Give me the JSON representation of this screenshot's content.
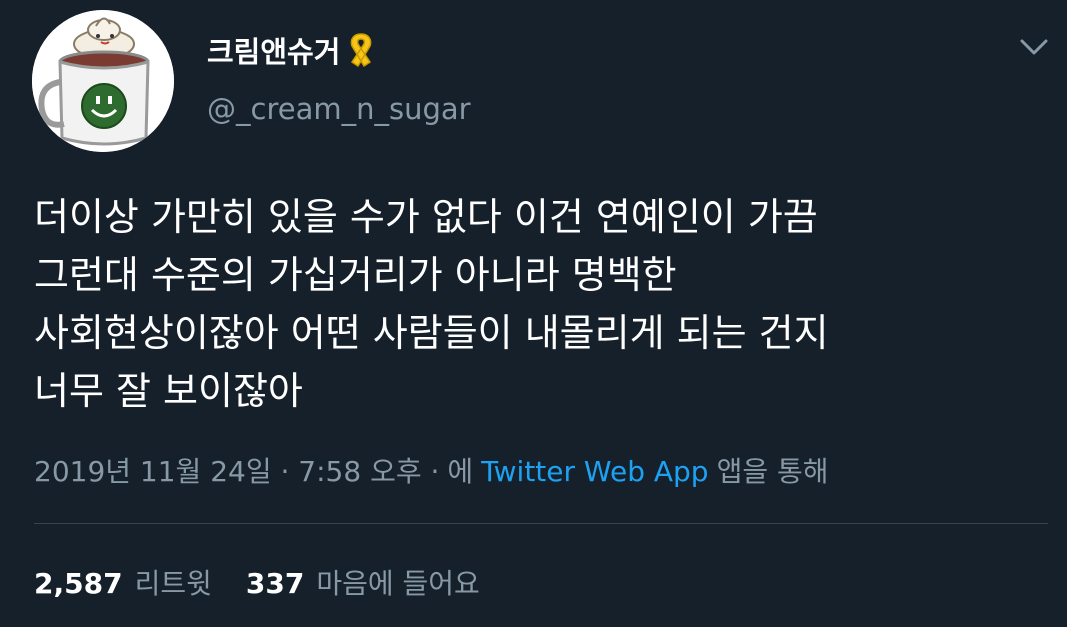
{
  "user": {
    "display_name": "크림앤슈거",
    "handle": "@_cream_n_sugar",
    "badge_icon": "yellow-ribbon-icon",
    "avatar_icon": "smiley-coffee-mug-icon"
  },
  "tweet": {
    "lines": [
      "더이상 가만히 있을 수가 없다 이건 연예인이 가끔",
      "그런대 수준의 가십거리가 아니라 명백한",
      "사회현상이잖아 어떤 사람들이 내몰리게 되는 건지",
      "너무 잘 보이잖아"
    ],
    "timestamp": "2019년 11월 24일 · 7:58 오후 ·",
    "via_prefix": "에",
    "source_app": "Twitter Web App",
    "via_suffix": "앱을 통해"
  },
  "stats": {
    "retweets_count": "2,587",
    "retweets_label": "리트윗",
    "likes_count": "337",
    "likes_label": "마음에 들어요"
  },
  "colors": {
    "background": "#15202b",
    "primary_text": "#ffffff",
    "secondary_text": "#8899a6",
    "link": "#1da1f2",
    "divider": "#38444d",
    "ribbon": "#f5c518"
  }
}
